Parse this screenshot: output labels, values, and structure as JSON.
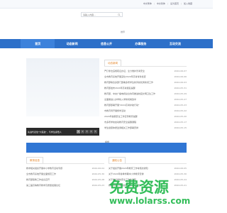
{
  "top_links": [
    "中文繁体",
    "中文简体",
    "设为首页",
    "加入收藏"
  ],
  "search": {
    "placeholder": "请输入内容..."
  },
  "hot": "推荐",
  "nav": {
    "items": [
      "首页",
      "动态新闻",
      "信息公开",
      "办事服务",
      "互动交流"
    ]
  },
  "banner": {
    "caption": "先进代表性\"大思政\"，与学生感悟人",
    "pages": [
      "1",
      "2",
      "3",
      "4",
      "5"
    ]
  },
  "news": {
    "tab": "动态新闻",
    "items": [
      {
        "title": "严打非法违规疏证办证，全力维护普考安全",
        "date": "2024-06-07"
      },
      {
        "title": "全市教育系统开展深化2024年高考考务检查",
        "date": "2024-06-06"
      },
      {
        "title": "教育部联合多部门部署多所学生新风校优秀新闻工作",
        "date": "2024-06-03"
      },
      {
        "title": "教育部发布2024年高考报名提醒",
        "date": "2024-05-31"
      },
      {
        "title": "教育部、中央广播电视总台协同推进校园文明卫生工作",
        "date": "2024-05-29"
      },
      {
        "title": "全面推进公办学校入学新机制改革",
        "date": "2024-05-27"
      },
      {
        "title": "教育部部署开展\"2024高考护航行动\"",
        "date": "2024-05-23"
      },
      {
        "title": "市教育局开展督学活动",
        "date": "2024-05-22"
      },
      {
        "title": "2024年暑假安全工作宣传教育提醒",
        "date": "2024-05-20"
      },
      {
        "title": "市多所学校启动教育安全提醒课程",
        "date": "2024-05-17"
      },
      {
        "title": "学生健康体质监测相关工作部署安排",
        "date": "2024-05-15"
      }
    ]
  },
  "ad_label": "横幅",
  "bottom": {
    "left": {
      "tab": "教育信息",
      "items": [
        {
          "title": "教学相关组织开展中小学教育活动专题",
          "date": "2024-06-04"
        },
        {
          "title": "全市教育系统开展全面规范工作",
          "date": "2024-05-30"
        },
        {
          "title": "教育部职教工作会议召开",
          "date": "2024-05-28"
        },
        {
          "title": "第三届高等教育教学高质量发展论坛",
          "date": "2024-05-23"
        }
      ]
    },
    "right": {
      "tab": "通知公告",
      "items": [
        {
          "title": "关于组织开展2024年教育工作考核的通知",
          "date": "2024-06-05"
        },
        {
          "title": "关于2024年春季学期中小学教育安排",
          "date": "2024-05-30"
        },
        {
          "title": "关于做好学校安全工作的通知",
          "date": "2024-05-24"
        },
        {
          "title": "教育局中小学校新任人才遴选公告",
          "date": "2024-05-21"
        }
      ]
    }
  },
  "watermark": {
    "line1": "免费资源",
    "line2": "www.lolarss.com"
  }
}
